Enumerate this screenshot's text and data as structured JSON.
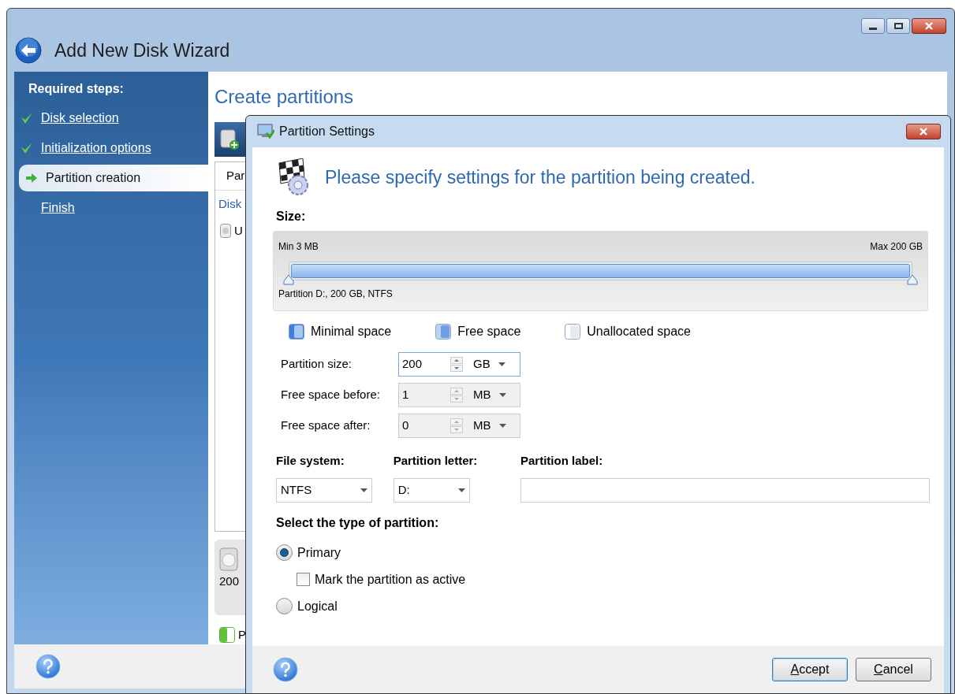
{
  "window": {
    "title": "Add New Disk Wizard"
  },
  "sidebar": {
    "heading": "Required steps:",
    "steps": [
      {
        "label": "Disk selection",
        "kind": "done",
        "selected": false
      },
      {
        "label": "Initialization options",
        "kind": "done",
        "selected": false
      },
      {
        "label": "Partition creation",
        "kind": "current",
        "selected": true
      },
      {
        "label": "Finish",
        "kind": "pending",
        "selected": false
      }
    ]
  },
  "page": {
    "title": "Create partitions",
    "table": {
      "column_1": "Par",
      "row_1": "Disk",
      "row_2": "U"
    },
    "disk_card": {
      "size": "200"
    },
    "legend": {
      "label": "P"
    }
  },
  "dialog": {
    "title": "Partition Settings",
    "heading": "Please specify settings for the partition being created.",
    "size": {
      "label": "Size:",
      "min": "Min 3 MB",
      "max": "Max 200 GB",
      "caption": "Partition D:, 200 GB, NTFS",
      "level": 1
    },
    "legend": [
      {
        "label": "Minimal space",
        "kind": "minimal"
      },
      {
        "label": "Free space",
        "kind": "free"
      },
      {
        "label": "Unallocated space",
        "kind": "unallocated"
      }
    ],
    "spinners": [
      {
        "label": "Partition size:",
        "value": "200",
        "unit": "GB",
        "disabled": false
      },
      {
        "label": "Free space before:",
        "value": "1",
        "unit": "MB",
        "disabled": true
      },
      {
        "label": "Free space after:",
        "value": "0",
        "unit": "MB",
        "disabled": true
      }
    ],
    "options": [
      {
        "label": "File system:",
        "kind": "select",
        "value": "NTFS"
      },
      {
        "label": "Partition letter:",
        "kind": "select",
        "value": "D:"
      },
      {
        "label": "Partition label:",
        "kind": "text"
      }
    ],
    "partition_type": {
      "label": "Select the type of partition:",
      "items": [
        {
          "kind": "radio",
          "label": "Primary",
          "selected": true
        },
        {
          "kind": "checkbox",
          "label": "Mark the partition as active",
          "checked": false
        },
        {
          "kind": "radio",
          "label": "Logical",
          "selected": false
        }
      ]
    },
    "buttons": [
      {
        "label": "Accept",
        "default": true
      },
      {
        "label": "Cancel",
        "default": false
      }
    ]
  }
}
